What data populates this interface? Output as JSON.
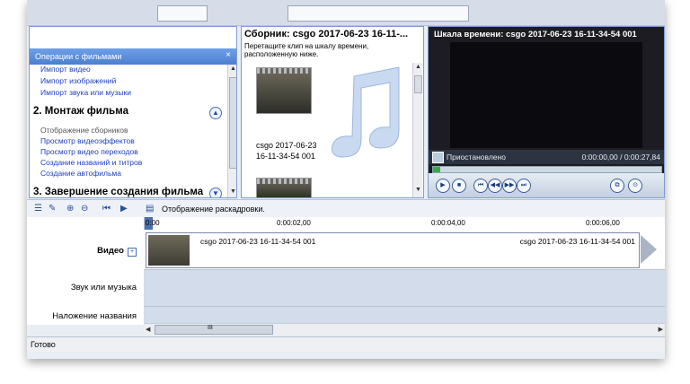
{
  "tasks": {
    "header": "Операции с фильмами",
    "close": "×",
    "import_links": [
      "Импорт видео",
      "Импорт изображений",
      "Импорт звука или музыки"
    ],
    "section2": "2. Монтаж фильма",
    "edit_links": [
      "Отображение сборников",
      "Просмотр видеоэффектов",
      "Просмотр видео переходов",
      "Создание названий и титров",
      "Создание автофильма"
    ],
    "section3": "3. Завершение создания фильма"
  },
  "collection": {
    "title": "Сборник: csgo 2017-06-23 16-11-...",
    "desc_line1": "Перетащите клип на шкалу времени,",
    "desc_line2": "расположенную ниже.",
    "clip_name_line1": "csgo 2017-06-23",
    "clip_name_line2": "16-11-34-54 001"
  },
  "monitor": {
    "title": "Шкала времени: csgo 2017-06-23 16-11-34-54 001",
    "status": "Приостановлено",
    "time": "0:00:00,00 / 0:00:27,84"
  },
  "timeline": {
    "toolbar_label": "Отображение раскадровки.",
    "ruler": [
      "0:00",
      "0:00:02,00",
      "0:00:04,00",
      "0:00:06,00"
    ],
    "tracks": {
      "video": "Видео",
      "audio": "Звук или музыка",
      "title_overlay": "Наложение названия"
    },
    "clip_label": "csgo 2017-06-23 16-11-34-54 001",
    "scroll_marker": "III"
  },
  "status_bar": "Готово"
}
